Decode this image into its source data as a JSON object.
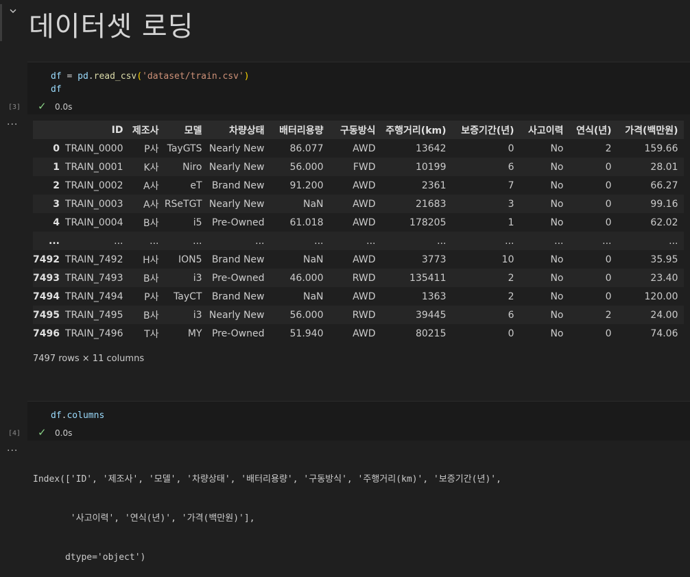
{
  "heading": {
    "title": "데이터셋 로딩"
  },
  "cell1": {
    "exec_count": "[3]",
    "line1": {
      "var": "df",
      "op": " = ",
      "mod": "pd",
      "dot": ".",
      "fn": "read_csv",
      "lparen": "(",
      "str": "'dataset/train.csv'",
      "rparen": ")"
    },
    "line2": "df",
    "status": "0.0s",
    "output_menu": "···"
  },
  "dataframe": {
    "columns": [
      "",
      "ID",
      "제조사",
      "모델",
      "차량상태",
      "배터리용량",
      "구동방식",
      "주행거리(km)",
      "보증기간(년)",
      "사고이력",
      "연식(년)",
      "가격(백만원)"
    ],
    "rows": [
      [
        "0",
        "TRAIN_0000",
        "P사",
        "TayGTS",
        "Nearly New",
        "86.077",
        "AWD",
        "13642",
        "0",
        "No",
        "2",
        "159.66"
      ],
      [
        "1",
        "TRAIN_0001",
        "K사",
        "Niro",
        "Nearly New",
        "56.000",
        "FWD",
        "10199",
        "6",
        "No",
        "0",
        "28.01"
      ],
      [
        "2",
        "TRAIN_0002",
        "A사",
        "eT",
        "Brand New",
        "91.200",
        "AWD",
        "2361",
        "7",
        "No",
        "0",
        "66.27"
      ],
      [
        "3",
        "TRAIN_0003",
        "A사",
        "RSeTGT",
        "Nearly New",
        "NaN",
        "AWD",
        "21683",
        "3",
        "No",
        "0",
        "99.16"
      ],
      [
        "4",
        "TRAIN_0004",
        "B사",
        "i5",
        "Pre-Owned",
        "61.018",
        "AWD",
        "178205",
        "1",
        "No",
        "0",
        "62.02"
      ],
      [
        "...",
        "...",
        "...",
        "...",
        "...",
        "...",
        "...",
        "...",
        "...",
        "...",
        "...",
        "..."
      ],
      [
        "7492",
        "TRAIN_7492",
        "H사",
        "ION5",
        "Brand New",
        "NaN",
        "AWD",
        "3773",
        "10",
        "No",
        "0",
        "35.95"
      ],
      [
        "7493",
        "TRAIN_7493",
        "B사",
        "i3",
        "Pre-Owned",
        "46.000",
        "RWD",
        "135411",
        "2",
        "No",
        "0",
        "23.40"
      ],
      [
        "7494",
        "TRAIN_7494",
        "P사",
        "TayCT",
        "Brand New",
        "NaN",
        "AWD",
        "1363",
        "2",
        "No",
        "0",
        "120.00"
      ],
      [
        "7495",
        "TRAIN_7495",
        "B사",
        "i3",
        "Nearly New",
        "56.000",
        "RWD",
        "39445",
        "6",
        "No",
        "2",
        "24.00"
      ],
      [
        "7496",
        "TRAIN_7496",
        "T사",
        "MY",
        "Pre-Owned",
        "51.940",
        "AWD",
        "80215",
        "0",
        "No",
        "0",
        "74.06"
      ]
    ],
    "shape": "7497 rows × 11 columns"
  },
  "cell2": {
    "exec_count": "[4]",
    "line1": {
      "var": "df",
      "dot": ".",
      "attr": "columns"
    },
    "status": "0.0s",
    "output_menu": "···",
    "output_lines": [
      "Index(['ID', '제조사', '모델', '차량상태', '배터리용량', '구동방식', '주행거리(km)', '보증기간(년)',",
      "       '사고이력', '연식(년)', '가격(백만원)'],",
      "      dtype='object')"
    ]
  },
  "colors": {
    "background": "#1f1f1f",
    "check": "#89d185",
    "string": "#ce9178",
    "variable": "#9cdcfe",
    "function": "#dcdcaa"
  }
}
